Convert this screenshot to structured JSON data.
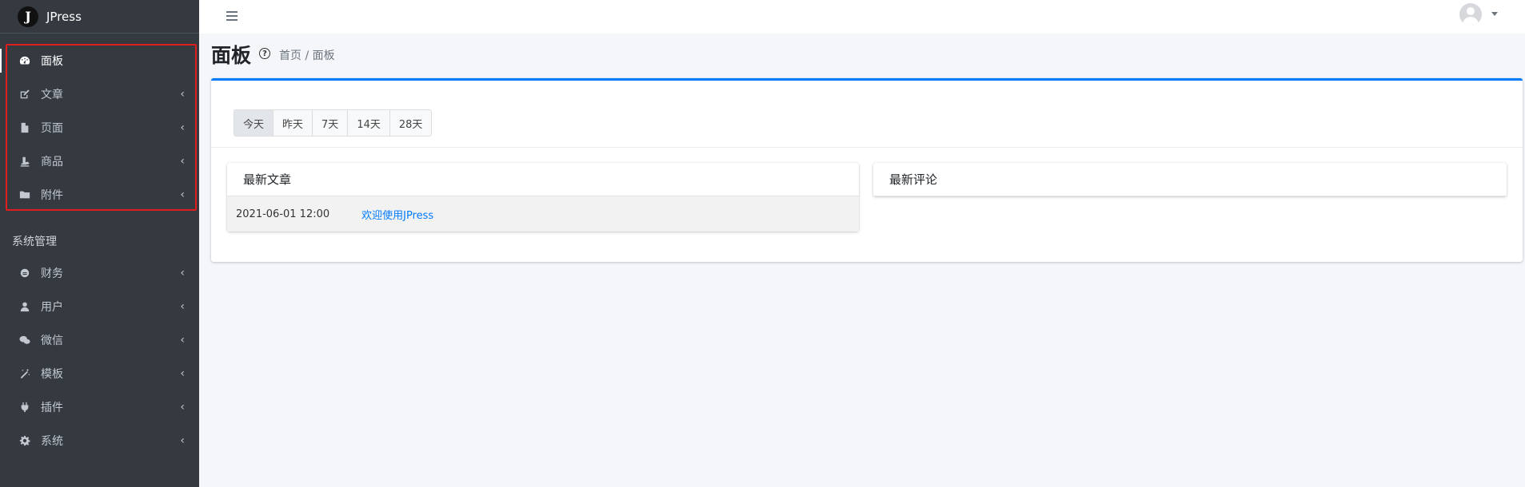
{
  "brand": {
    "logo_letter": "J",
    "name": "JPress"
  },
  "sidebar": {
    "items": [
      {
        "label": "面板",
        "icon": "dashboard-icon",
        "active": true,
        "has_arrow": false
      },
      {
        "label": "文章",
        "icon": "edit-icon",
        "has_arrow": true
      },
      {
        "label": "页面",
        "icon": "file-icon",
        "has_arrow": true
      },
      {
        "label": "商品",
        "icon": "product-icon",
        "has_arrow": true
      },
      {
        "label": "附件",
        "icon": "folder-icon",
        "has_arrow": true
      }
    ],
    "section_header": "系统管理",
    "system_items": [
      {
        "label": "财务",
        "icon": "finance-icon",
        "has_arrow": true
      },
      {
        "label": "用户",
        "icon": "user-icon",
        "has_arrow": true
      },
      {
        "label": "微信",
        "icon": "wechat-icon",
        "has_arrow": true
      },
      {
        "label": "模板",
        "icon": "template-icon",
        "has_arrow": true
      },
      {
        "label": "插件",
        "icon": "plugin-icon",
        "has_arrow": true
      },
      {
        "label": "系统",
        "icon": "gear-icon",
        "has_arrow": true
      }
    ],
    "arrow_glyph": "‹"
  },
  "header": {
    "title": "面板",
    "help_glyph": "?",
    "breadcrumb": {
      "home": "首页",
      "separator": " / ",
      "current": "面板"
    }
  },
  "filters": {
    "options": [
      "今天",
      "昨天",
      "7天",
      "14天",
      "28天"
    ],
    "selected": "今天"
  },
  "latest_articles": {
    "title": "最新文章",
    "rows": [
      {
        "date": "2021-06-01 12:00",
        "title": "欢迎使用JPress"
      }
    ]
  },
  "latest_comments": {
    "title": "最新评论"
  },
  "colors": {
    "sidebar_bg": "#343a40",
    "accent": "#007bff",
    "highlight": "#e11d1d",
    "page_bg": "#f4f6f9"
  }
}
